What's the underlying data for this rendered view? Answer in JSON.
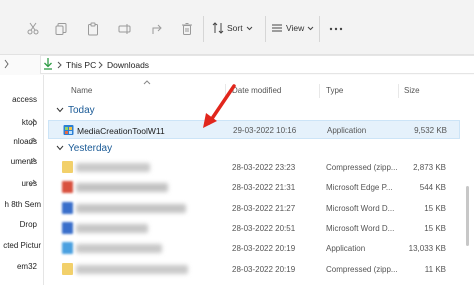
{
  "toolbar": {
    "sort_label": "Sort",
    "view_label": "View",
    "icons": [
      "cut-icon",
      "copy-icon",
      "paste-icon",
      "rename-icon",
      "share-icon",
      "delete-icon",
      "sort-icon",
      "view-icon",
      "chevron-down-icon",
      "more-icon"
    ]
  },
  "address": {
    "crumbs": [
      "This PC",
      "Downloads"
    ]
  },
  "nav": {
    "items": [
      "access",
      "ktop",
      "nloads",
      "uments",
      "ures",
      "h 8th Sem",
      "Drop",
      "cted Pictur",
      "em32"
    ]
  },
  "columns": {
    "name": "Name",
    "date": "Date modified",
    "type": "Type",
    "size": "Size"
  },
  "groups": {
    "today": "Today",
    "yesterday": "Yesterday"
  },
  "files": [
    {
      "name": "MediaCreationToolW11",
      "date": "29-03-2022 10:16",
      "type": "Application",
      "size": "9,532 KB",
      "color": "#3f8fd9"
    },
    {
      "name": "",
      "date": "28-03-2022 23:23",
      "type": "Compressed (zipp...",
      "size": "2,873 KB",
      "color": "#e8c04e"
    },
    {
      "name": "",
      "date": "28-03-2022 21:31",
      "type": "Microsoft Edge P...",
      "size": "544 KB",
      "color": "#d94a3d"
    },
    {
      "name": "",
      "date": "28-03-2022 21:27",
      "type": "Microsoft Word D...",
      "size": "15 KB",
      "color": "#2f66c2"
    },
    {
      "name": "",
      "date": "28-03-2022 20:51",
      "type": "Microsoft Word D...",
      "size": "15 KB",
      "color": "#2f66c2"
    },
    {
      "name": "",
      "date": "28-03-2022 20:19",
      "type": "Application",
      "size": "13,033 KB",
      "color": "#3a8fd0"
    },
    {
      "name": "",
      "date": "28-03-2022 20:19",
      "type": "Compressed (zipp...",
      "size": "11 KB",
      "color": "#e8c04e"
    }
  ]
}
